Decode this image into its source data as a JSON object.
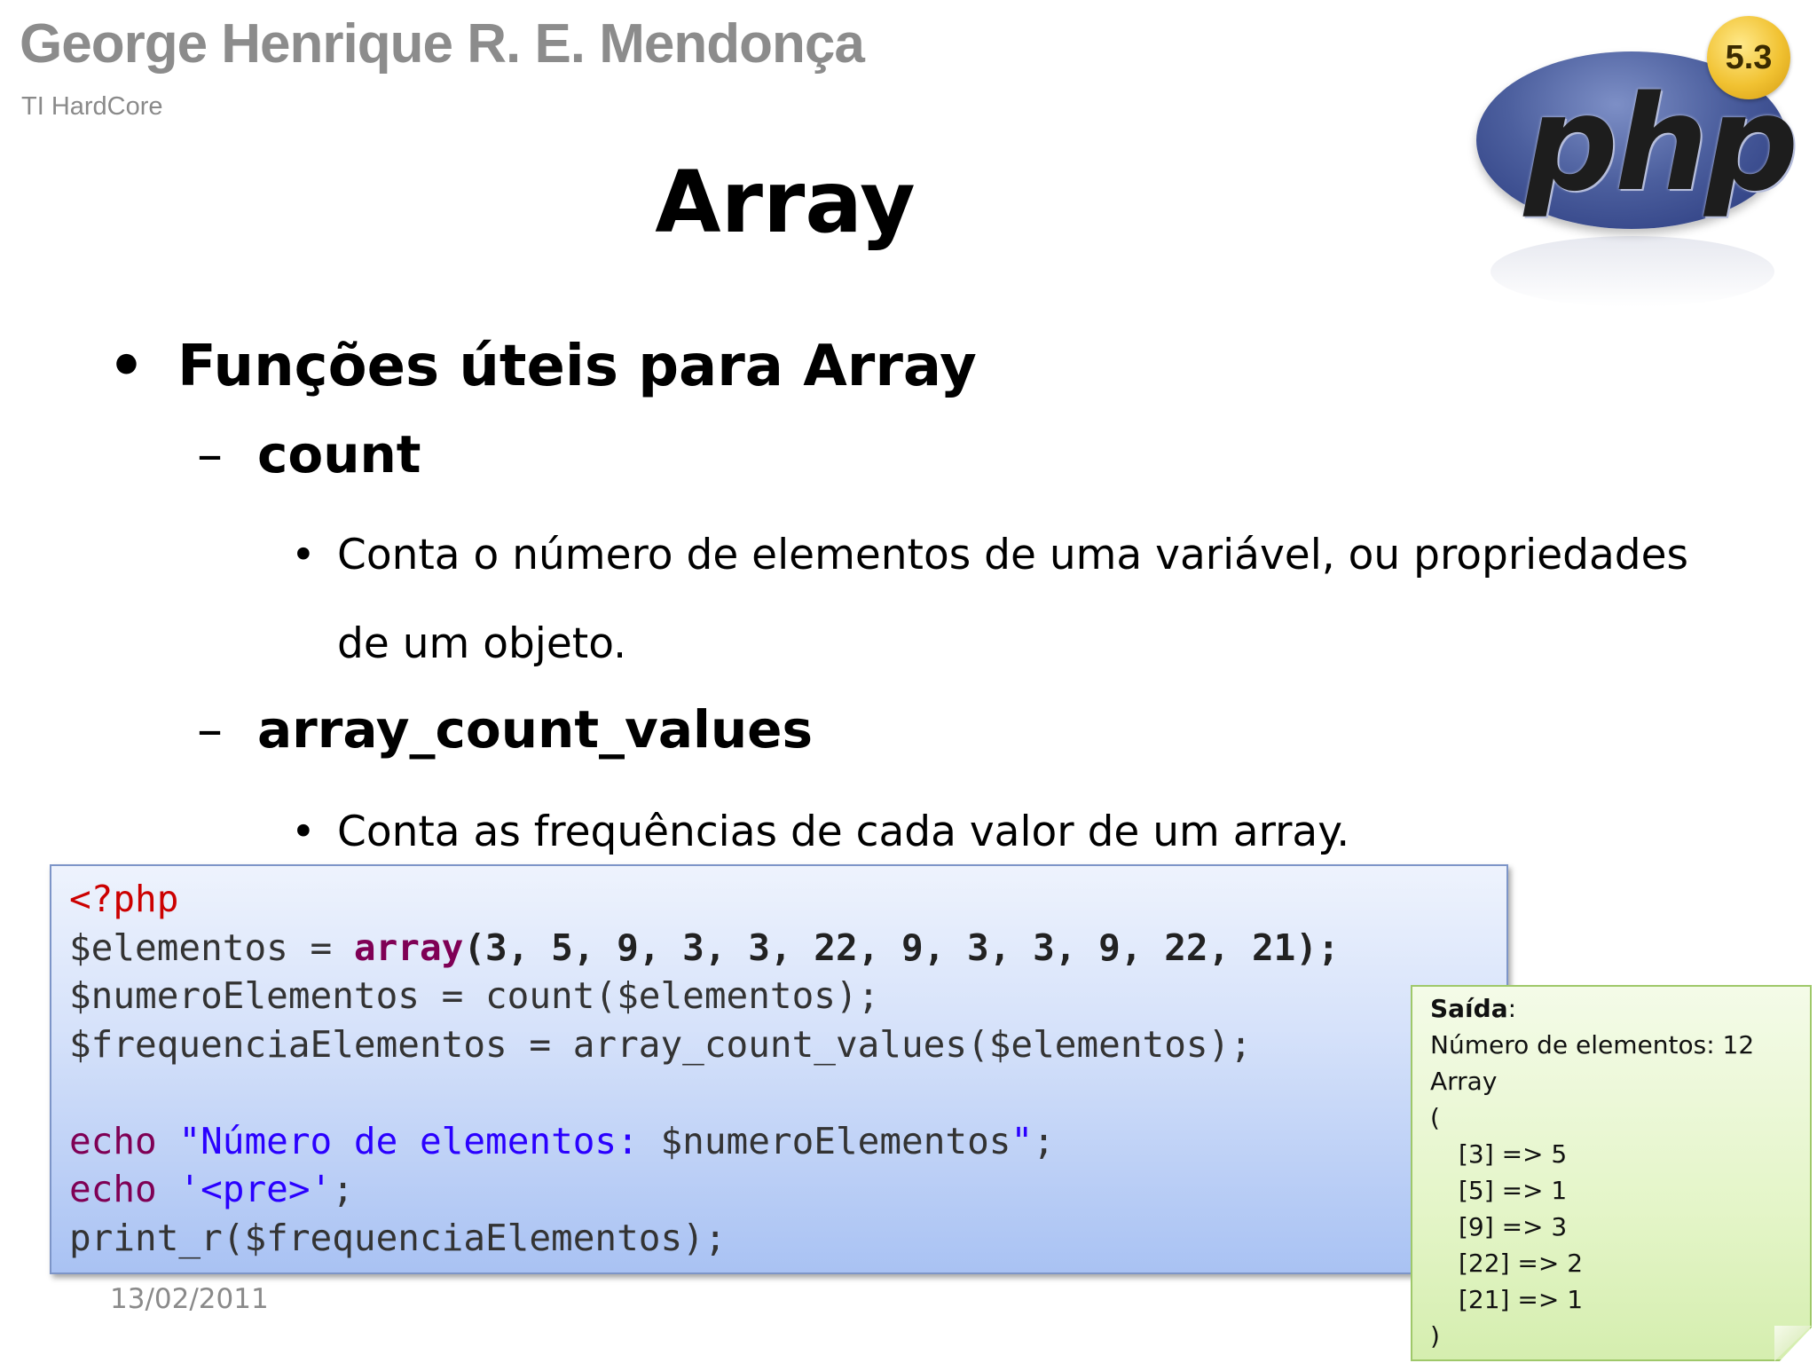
{
  "header": {
    "author": "George Henrique R. E. Mendonça",
    "organization": "TI HardCore"
  },
  "logo": {
    "text": "php",
    "version": "5.3"
  },
  "slide": {
    "title": "Array",
    "bullet": "Funções úteis para Array",
    "items": [
      {
        "name": "count",
        "description_line1": "Conta o número de elementos de uma variável, ou propriedades",
        "description_line2": "de um objeto."
      },
      {
        "name": "array_count_values",
        "description_line1": "Conta as frequências de cada valor de um array."
      }
    ],
    "bullet_symbol": "•",
    "dash_symbol": "–"
  },
  "code": {
    "line1": "<?php",
    "line2_var": "$elementos = ",
    "line2_kw": "array",
    "line2_args": "(3, 5, 9, 3, 3, 22, 9, 3, 3, 9, 22, 21);",
    "line3": "$numeroElementos = count($elementos);",
    "line4": "$frequenciaElementos = array_count_values($elementos);",
    "line6_kw": "echo",
    "line6_str": "\"Número de elementos: ",
    "line6_var": "$numeroElementos",
    "line6_end_str": "\"",
    "line6_end": ";",
    "line7_kw": "echo",
    "line7_str": "'<pre>'",
    "line7_end": ";",
    "line8": "print_r($frequenciaElementos);"
  },
  "output": {
    "label": "Saída",
    "colon": ":",
    "lines": [
      "Número de elementos: 12",
      "Array",
      "("
    ],
    "entries": [
      "[3] => 5",
      "[5] => 1",
      "[9] => 3",
      "[22] => 2",
      "[21] => 1"
    ],
    "closing": ")"
  },
  "footer": {
    "date": "13/02/2011"
  }
}
